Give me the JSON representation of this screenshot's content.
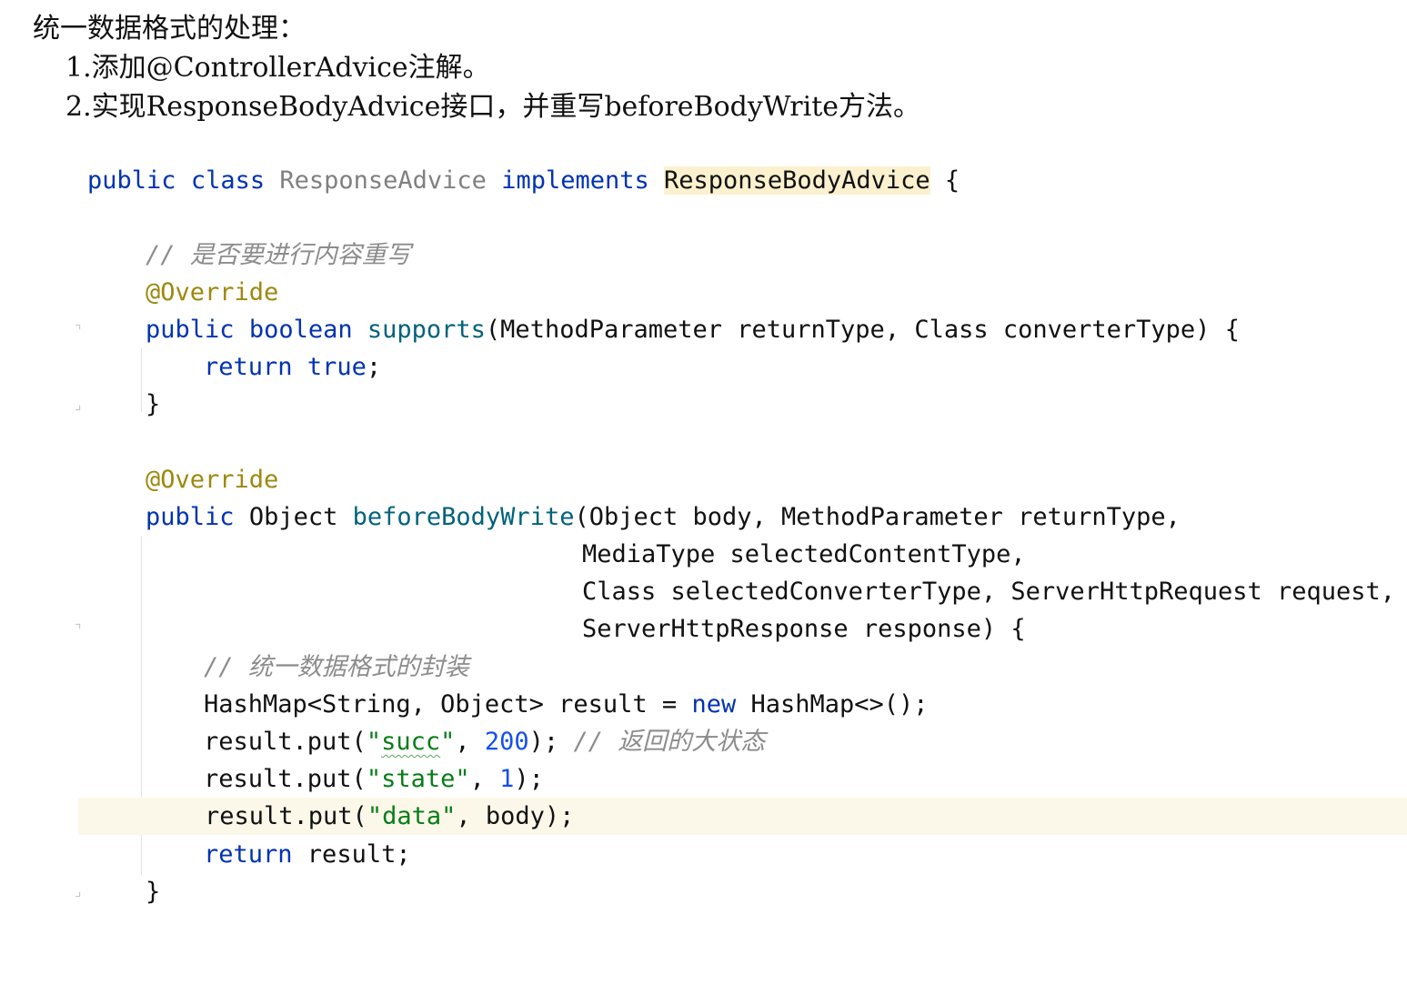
{
  "notes": {
    "heading": "统一数据格式的处理：",
    "steps": [
      "1.添加@ControllerAdvice注解。",
      "2.实现ResponseBodyAdvice接口，并重写beforeBodyWrite方法。"
    ]
  },
  "code": {
    "class_decl": {
      "kw_public": "public",
      "kw_class": "class",
      "class_name": "ResponseAdvice",
      "kw_implements": "implements",
      "interface": "ResponseBodyAdvice",
      "brace": " {"
    },
    "comment1": "// 是否要进行内容重写",
    "annotation1": "@Override",
    "supports_sig": {
      "kw_public": "public",
      "kw_boolean": "boolean",
      "name": "supports",
      "params": "(MethodParameter returnType, Class converterType) {"
    },
    "return_true": {
      "kw_return": "return",
      "kw_true": "true",
      "semi": ";"
    },
    "close1": "}",
    "annotation2": "@Override",
    "before_sig": {
      "kw_public": "public",
      "ret_type": "Object",
      "name": "beforeBodyWrite",
      "params1": "(Object body, MethodParameter returnType,",
      "params2": "MediaType selectedContentType,",
      "params3": "Class selectedConverterType, ServerHttpRequest request,",
      "params4": "ServerHttpResponse response) {"
    },
    "comment2": "// 统一数据格式的封装",
    "map_decl": {
      "pre": "HashMap<String, Object> result = ",
      "kw_new": "new",
      "post": " HashMap<>();"
    },
    "put_succ": {
      "pre": "result.put(",
      "q1": "\"",
      "key": "succ",
      "q2": "\"",
      "mid": ", ",
      "value": "200",
      "post": "); ",
      "comment": "// 返回的大状态"
    },
    "put_state": {
      "pre": "result.put(",
      "key": "\"state\"",
      "mid": ", ",
      "value": "1",
      "post": ");"
    },
    "put_data": {
      "pre": "result.put(",
      "key": "\"data\"",
      "post": ", body);"
    },
    "return_result": {
      "kw_return": "return",
      "post": " result;"
    },
    "close2": "}"
  },
  "colors": {
    "keyword": "#0033b3",
    "unused_class": "#808080",
    "method": "#00627a",
    "annotation": "#9e880d",
    "string": "#067d17",
    "number": "#1750eb",
    "comment": "#8c8c8c",
    "highlight": "#fbf1cf",
    "caret_row": "#fbf8ea"
  },
  "icons": [
    "fold-icon"
  ]
}
